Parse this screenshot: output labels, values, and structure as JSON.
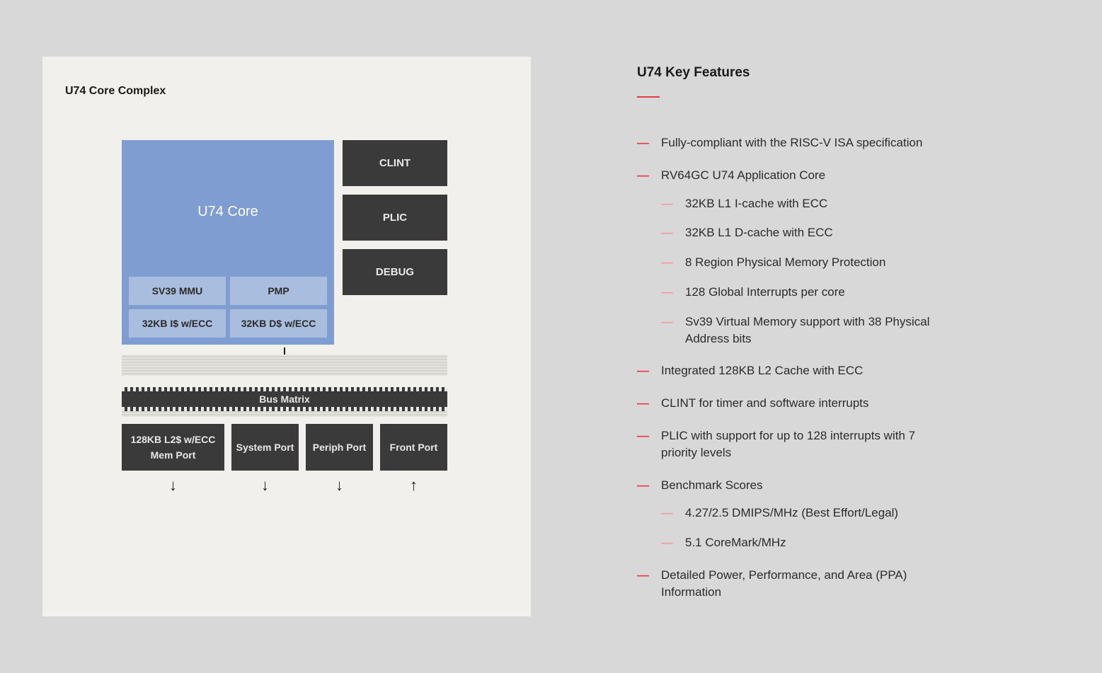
{
  "diagram": {
    "title": "U74 Core Complex",
    "core_label": "U74 Core",
    "core_sub": [
      "SV39 MMU",
      "PMP",
      "32KB I$ w/ECC",
      "32KB D$ w/ECC"
    ],
    "side_blocks": [
      "CLINT",
      "PLIC",
      "DEBUG"
    ],
    "bus_matrix": "Bus Matrix",
    "ports": [
      {
        "line1": "128KB L2$ w/ECC",
        "line2": "Mem Port"
      },
      {
        "line1": "System Port"
      },
      {
        "line1": "Periph Port"
      },
      {
        "line1": "Front Port"
      }
    ],
    "arrows": [
      "↓",
      "↓",
      "↓",
      "↑"
    ]
  },
  "features": {
    "title": "U74 Key Features",
    "items": [
      {
        "text": "Fully-compliant with the RISC-V ISA specification"
      },
      {
        "text": "RV64GC U74 Application Core",
        "children": [
          "32KB L1 I-cache with ECC",
          "32KB L1 D-cache with ECC",
          "8 Region Physical Memory Protection",
          "128 Global Interrupts per core",
          "Sv39 Virtual Memory support with 38 Physical Address bits"
        ]
      },
      {
        "text": "Integrated 128KB L2 Cache with ECC"
      },
      {
        "text": "CLINT for timer and software interrupts"
      },
      {
        "text": "PLIC with support for up to 128 interrupts with 7 priority levels"
      },
      {
        "text": "Benchmark Scores",
        "children": [
          "4.27/2.5 DMIPS/MHz (Best Effort/Legal)",
          "5.1 CoreMark/MHz"
        ]
      },
      {
        "text": "Detailed Power, Performance, and Area (PPA) Information"
      }
    ]
  }
}
